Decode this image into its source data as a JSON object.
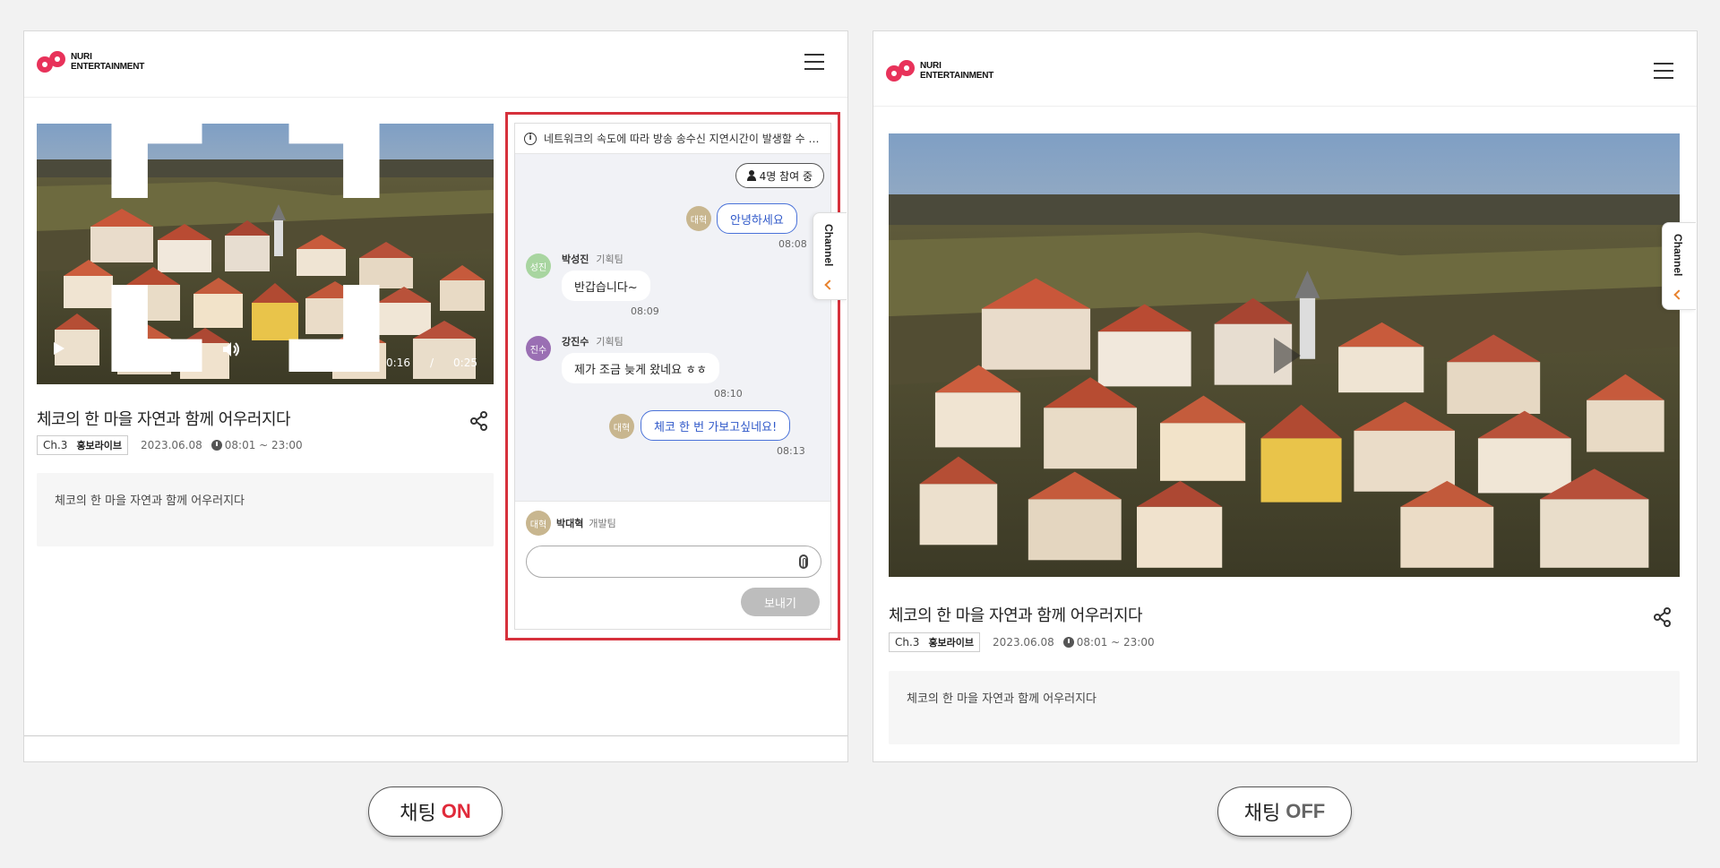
{
  "brand": {
    "logo_line1": "NURI",
    "logo_line2": "ENTERTAINMENT",
    "accent": "#e8325a"
  },
  "video": {
    "title": "체코의 한 마을 자연과 함께 어우러지다",
    "channel": "Ch.3",
    "badge": "홍보라이브",
    "date": "2023.06.08",
    "time_range": "08:01 ~ 23:00",
    "description": "체코의 한 마을 자연과 함께 어우러지다",
    "current_time": "0:16",
    "time_separator": "/",
    "duration": "0:25"
  },
  "chat": {
    "notice": "네트워크의 속도에 따라 방송 송수신 지연시간이 발생할 수 있습니다.",
    "participants": "4명 참여 중",
    "messages": [
      {
        "sender_avatar": "대혁",
        "text": "안녕하세요",
        "time": "08:08",
        "mine": true
      },
      {
        "sender_avatar": "성진",
        "sender": "박성진",
        "team": "기획팀",
        "text": "반갑습니다~",
        "time": "08:09",
        "mine": false
      },
      {
        "sender_avatar": "진수",
        "sender": "강진수",
        "team": "기획팀",
        "text": "제가 조금 늦게 왔네요 ㅎㅎ",
        "time": "08:10",
        "mine": false
      },
      {
        "sender_avatar": "대혁",
        "text": "체코 한 번 가보고싶네요!",
        "time": "08:13",
        "mine": true
      }
    ],
    "current_user": {
      "avatar": "대혁",
      "name": "박대혁",
      "team": "개발팀"
    },
    "input_placeholder": "",
    "send_label": "보내기",
    "border_color": "#d6313c"
  },
  "channel_tab": {
    "label": "Channel"
  },
  "toggles": {
    "on": {
      "prefix": "채팅",
      "state": "ON",
      "color": "#e02a3a"
    },
    "off": {
      "prefix": "채팅",
      "state": "OFF",
      "color": "#666666"
    }
  },
  "icons": [
    "menu-icon",
    "play-icon",
    "volume-icon",
    "fullscreen-icon",
    "share-icon",
    "clock-icon",
    "info-icon",
    "person-icon",
    "paperclip-icon",
    "chevron-left-icon"
  ]
}
